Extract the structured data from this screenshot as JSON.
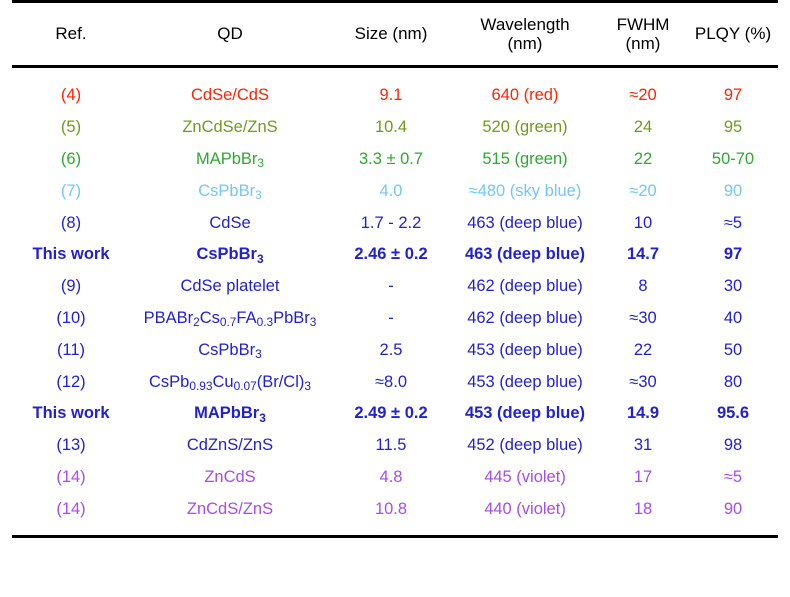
{
  "table": {
    "columns": [
      {
        "id": "ref",
        "label": "Ref.",
        "label_line2": ""
      },
      {
        "id": "qd",
        "label": "QD",
        "label_line2": ""
      },
      {
        "id": "size",
        "label": "Size (nm)",
        "label_line2": ""
      },
      {
        "id": "wave",
        "label": "Wavelength",
        "label_line2": "(nm)"
      },
      {
        "id": "fwhm",
        "label": "FWHM",
        "label_line2": "(nm)"
      },
      {
        "id": "plqy",
        "label": "PLQY (%)",
        "label_line2": ""
      }
    ],
    "colors": {
      "red": "#FF2400",
      "olive_green": "#6E9B1E",
      "green": "#2FA82F",
      "sky_blue": "#73C6F5",
      "blue": "#2222CC",
      "violet": "#A64DE8",
      "black": "#000000"
    },
    "rows": [
      {
        "ref": "(4)",
        "qd": "CdSe/CdS",
        "size": "9.1",
        "wavelength": "640 (red)",
        "fwhm": "≈20",
        "plqy": "97",
        "color": "#FF2400",
        "bold": false
      },
      {
        "ref": "(5)",
        "qd": "ZnCdSe/ZnS",
        "size": "10.4",
        "wavelength": "520 (green)",
        "fwhm": "24",
        "plqy": "95",
        "color": "#6E9B1E",
        "bold": false
      },
      {
        "ref": "(6)",
        "qd": "MAPbBr<sub>3</sub>",
        "size": "3.3 ± 0.7",
        "wavelength": "515 (green)",
        "fwhm": "22",
        "plqy": "50-70",
        "color": "#2FA82F",
        "bold": false
      },
      {
        "ref": "(7)",
        "qd": "CsPbBr<sub>3</sub>",
        "size": "4.0",
        "wavelength": "≈480 (sky blue)",
        "fwhm": "≈20",
        "plqy": "90",
        "color": "#73C6F5",
        "bold": false
      },
      {
        "ref": "(8)",
        "qd": "CdSe",
        "size": "1.7 - 2.2",
        "wavelength": "463 (deep blue)",
        "fwhm": "10",
        "plqy": "≈5",
        "color": "#2222CC",
        "bold": false
      },
      {
        "ref": "This work",
        "qd": "CsPbBr<sub>3</sub>",
        "size": "2.46 ± 0.2",
        "wavelength": "463 (deep blue)",
        "fwhm": "14.7",
        "plqy": "97",
        "color": "#2222CC",
        "bold": true
      },
      {
        "ref": "(9)",
        "qd": "CdSe platelet",
        "size": "-",
        "wavelength": "462 (deep blue)",
        "fwhm": "8",
        "plqy": "30",
        "color": "#2222CC",
        "bold": false
      },
      {
        "ref": "(10)",
        "qd": "PBABr<sub>2</sub>Cs<sub>0.7</sub>FA<sub>0.3</sub>PbBr<sub>3</sub>",
        "size": "-",
        "wavelength": "462 (deep blue)",
        "fwhm": "≈30",
        "plqy": "40",
        "color": "#2222CC",
        "bold": false
      },
      {
        "ref": "(11)",
        "qd": "CsPbBr<sub>3</sub>",
        "size": "2.5",
        "wavelength": "453 (deep blue)",
        "fwhm": "22",
        "plqy": "50",
        "color": "#2222CC",
        "bold": false
      },
      {
        "ref": "(12)",
        "qd": "CsPb<sub>0.93</sub>Cu<sub>0.07</sub>(Br/Cl)<sub>3</sub>",
        "size": "≈8.0",
        "wavelength": "453 (deep blue)",
        "fwhm": "≈30",
        "plqy": "80",
        "color": "#2222CC",
        "bold": false
      },
      {
        "ref": "This work",
        "qd": "MAPbBr<sub>3</sub>",
        "size": "2.49 ± 0.2",
        "wavelength": "453 (deep blue)",
        "fwhm": "14.9",
        "plqy": "95.6",
        "color": "#2222CC",
        "bold": true
      },
      {
        "ref": "(13)",
        "qd": "CdZnS/ZnS",
        "size": "11.5",
        "wavelength": "452 (deep blue)",
        "fwhm": "31",
        "plqy": "98",
        "color": "#2222CC",
        "bold": false
      },
      {
        "ref": "(14)",
        "qd": "ZnCdS",
        "size": "4.8",
        "wavelength": "445 (violet)",
        "fwhm": "17",
        "plqy": "≈5",
        "color": "#A64DE8",
        "bold": false
      },
      {
        "ref": "(14)",
        "qd": "ZnCdS/ZnS",
        "size": "10.8",
        "wavelength": "440 (violet)",
        "fwhm": "18",
        "plqy": "90",
        "color": "#A64DE8",
        "bold": false
      }
    ]
  }
}
